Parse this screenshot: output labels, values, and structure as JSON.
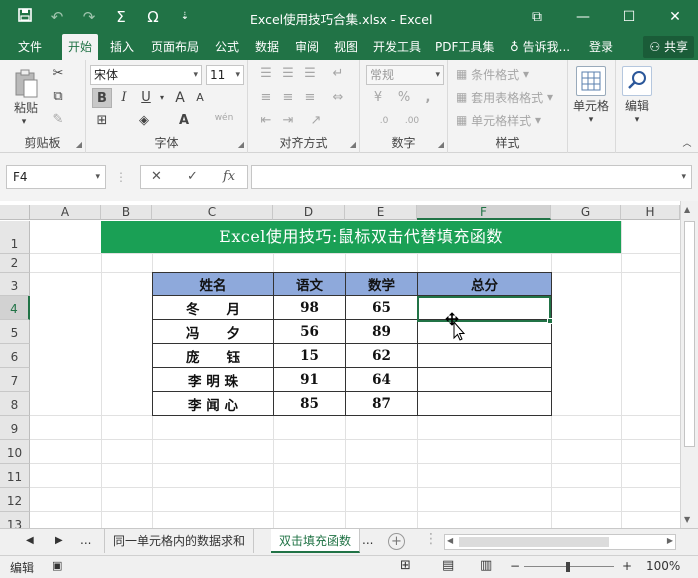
{
  "window": {
    "title": "Excel使用技巧合集.xlsx - Excel",
    "controls": [
      "⧉",
      "—",
      "☐",
      "✕"
    ]
  },
  "qat": {
    "save_icon": "save-icon",
    "undo_icon": "undo-icon",
    "redo_icon": "redo-icon",
    "sum_symbol": "Σ",
    "omega_symbol": "Ω",
    "customize": "⇣"
  },
  "tabs": [
    {
      "label": "文件"
    },
    {
      "label": "开始"
    },
    {
      "label": "插入"
    },
    {
      "label": "页面布局"
    },
    {
      "label": "公式"
    },
    {
      "label": "数据"
    },
    {
      "label": "审阅"
    },
    {
      "label": "视图"
    },
    {
      "label": "开发工具"
    },
    {
      "label": "PDF工具集"
    },
    {
      "label": "告诉我..."
    },
    {
      "label": "登录"
    },
    {
      "label": "共享"
    }
  ],
  "ribbon": {
    "clipboard": {
      "label": "剪贴板",
      "paste": "粘贴"
    },
    "font": {
      "label": "字体",
      "name": "宋体",
      "size": "11",
      "bold": "B",
      "italic": "I",
      "underline": "U",
      "grow": "A",
      "shrink": "A",
      "wen": "wén"
    },
    "alignment": {
      "label": "对齐方式"
    },
    "number": {
      "label": "数字",
      "format": "常规",
      "percent": "%",
      "comma": ",",
      "inc_decimal": ".0",
      "dec_decimal": ".00"
    },
    "styles": {
      "label": "样式",
      "conditional": "条件格式",
      "table": "套用表格格式",
      "cell_styles": "单元格样式"
    },
    "cells": {
      "label": "单元格"
    },
    "editing": {
      "label": "编辑"
    }
  },
  "formula_bar": {
    "name_box": "F4",
    "cancel": "✕",
    "enter": "✓",
    "fx": "fx",
    "value": ""
  },
  "grid": {
    "columns": [
      "A",
      "B",
      "C",
      "D",
      "E",
      "F",
      "G",
      "H"
    ],
    "rows": [
      "1",
      "2",
      "3",
      "4",
      "5",
      "6",
      "7",
      "8",
      "9",
      "10",
      "11",
      "12",
      "13"
    ],
    "banner": "Excel使用技巧:鼠标双击代替填充函数",
    "table": {
      "headers": [
        "姓名",
        "语文",
        "数学",
        "总分"
      ],
      "rows": [
        [
          "冬　　月",
          "98",
          "65",
          ""
        ],
        [
          "冯　　夕",
          "56",
          "89",
          ""
        ],
        [
          "庞　　钰",
          "15",
          "62",
          ""
        ],
        [
          "李 明 珠",
          "91",
          "64",
          ""
        ],
        [
          "李 闻 心",
          "85",
          "87",
          ""
        ]
      ]
    }
  },
  "sheets": {
    "nav_prev": "◀",
    "nav_next": "▶",
    "more": "...",
    "tabs": [
      {
        "label": "同一单元格内的数据求和"
      },
      {
        "label": "双击填充函数"
      }
    ],
    "more_right": "...",
    "add": "+"
  },
  "status": {
    "mode": "编辑",
    "zoom": "100%",
    "zoom_minus": "−",
    "zoom_plus": "+"
  }
}
